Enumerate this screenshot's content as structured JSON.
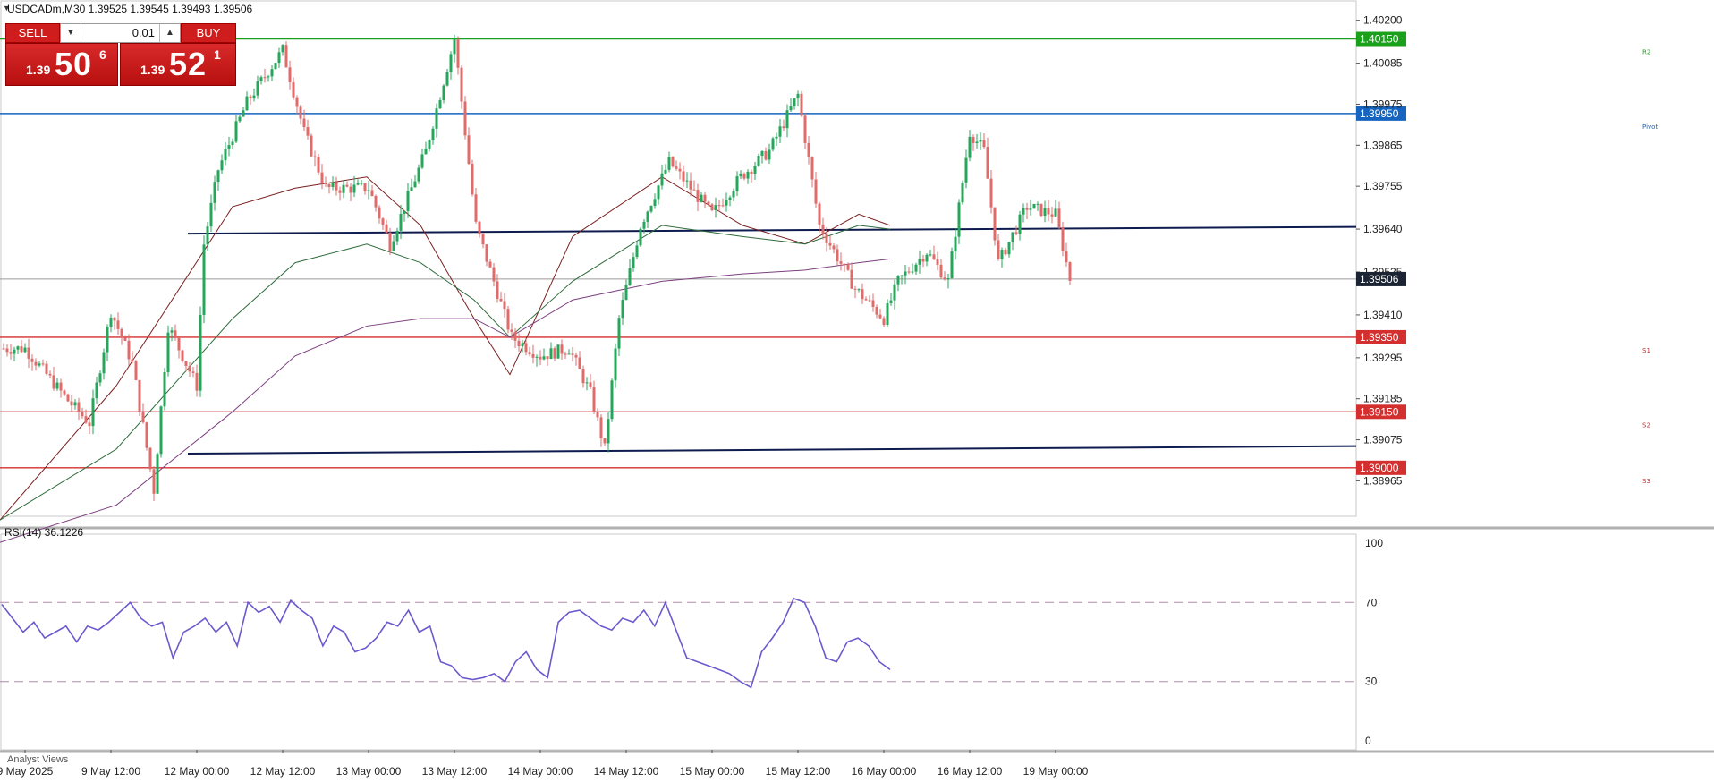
{
  "header": {
    "symbol_line": "USDCADm,M30  1.39525 1.39545 1.39493 1.39506",
    "symbol_icon": "triangle-down-icon"
  },
  "trade_panel": {
    "sell_label": "SELL",
    "buy_label": "BUY",
    "lot_value": "0.01",
    "sell_small": "1.39",
    "sell_big": "50",
    "sell_sup": "6",
    "buy_small": "1.39",
    "buy_big": "52",
    "buy_sup": "1",
    "accent": "#cf1c1c"
  },
  "rsi_label": "RSI(14) 36.1226",
  "analyst_tab": "Analyst Views",
  "chart_data": {
    "type": "candlestick",
    "symbol": "USDCADm",
    "timeframe": "M30",
    "ohlc_last": {
      "open": 1.39525,
      "high": 1.39545,
      "low": 1.39493,
      "close": 1.39506
    },
    "current_price": 1.39506,
    "current_price_label": "1.39506",
    "y_ticks": [
      "1.40200",
      "1.40085",
      "1.39975",
      "1.39865",
      "1.39755",
      "1.39640",
      "1.39525",
      "1.39410",
      "1.39295",
      "1.39185",
      "1.39075",
      "1.38965"
    ],
    "y_range": [
      1.3887,
      1.4024
    ],
    "x_ticks": [
      "9 May 2025",
      "9 May 12:00",
      "12 May 00:00",
      "12 May 12:00",
      "13 May 00:00",
      "13 May 12:00",
      "14 May 00:00",
      "14 May 12:00",
      "15 May 00:00",
      "15 May 12:00",
      "16 May 00:00",
      "16 May 12:00",
      "19 May 00:00"
    ],
    "levels": [
      {
        "name": "R2",
        "price": 1.4015,
        "label": "1.40150",
        "color": "#1aa01a"
      },
      {
        "name": "Pivot",
        "price": 1.3995,
        "label": "1.39950",
        "color": "#1565c0"
      },
      {
        "name": "S1",
        "price": 1.3935,
        "label": "1.39350",
        "color": "#d32f2f"
      },
      {
        "name": "S2",
        "price": 1.3915,
        "label": "1.39150",
        "color": "#d32f2f"
      },
      {
        "name": "S3",
        "price": 1.39,
        "label": "1.39000",
        "color": "#d32f2f"
      }
    ],
    "trendlines": [
      {
        "from": [
          "12 May 00:00",
          1.39628
        ],
        "to": [
          "right_edge",
          1.39646
        ],
        "color": "#0d1b4f"
      },
      {
        "from": [
          "12 May 00:00",
          1.39038
        ],
        "to": [
          "right_edge",
          1.39058
        ],
        "color": "#0d1b4f"
      }
    ],
    "price_path": [
      {
        "t": "9 May 2025",
        "p": 1.3932
      },
      {
        "t": "9 May 06:00",
        "p": 1.3918
      },
      {
        "t": "9 May 09:00",
        "p": 1.3912
      },
      {
        "t": "9 May 12:00",
        "p": 1.3942
      },
      {
        "t": "9 May 15:00",
        "p": 1.3928
      },
      {
        "t": "9 May 18:00",
        "p": 1.3894
      },
      {
        "t": "9 May 20:00",
        "p": 1.3938
      },
      {
        "t": "12 May 00:00",
        "p": 1.3922
      },
      {
        "t": "12 May 01:00",
        "p": 1.396
      },
      {
        "t": "12 May 03:00",
        "p": 1.398
      },
      {
        "t": "12 May 07:00",
        "p": 1.3998
      },
      {
        "t": "12 May 12:00",
        "p": 1.4012
      },
      {
        "t": "12 May 15:00",
        "p": 1.399
      },
      {
        "t": "12 May 18:00",
        "p": 1.3975
      },
      {
        "t": "13 May 00:00",
        "p": 1.3975
      },
      {
        "t": "13 May 03:00",
        "p": 1.396
      },
      {
        "t": "13 May 08:00",
        "p": 1.3985
      },
      {
        "t": "13 May 12:00",
        "p": 1.4015
      },
      {
        "t": "13 May 15:00",
        "p": 1.3965
      },
      {
        "t": "13 May 20:00",
        "p": 1.3935
      },
      {
        "t": "14 May 00:00",
        "p": 1.393
      },
      {
        "t": "14 May 04:00",
        "p": 1.3932
      },
      {
        "t": "14 May 07:00",
        "p": 1.392
      },
      {
        "t": "14 May 09:00",
        "p": 1.3905
      },
      {
        "t": "14 May 11:00",
        "p": 1.394
      },
      {
        "t": "14 May 14:00",
        "p": 1.3965
      },
      {
        "t": "14 May 18:00",
        "p": 1.3982
      },
      {
        "t": "15 May 00:00",
        "p": 1.3968
      },
      {
        "t": "15 May 04:00",
        "p": 1.3978
      },
      {
        "t": "15 May 08:00",
        "p": 1.3985
      },
      {
        "t": "15 May 12:00",
        "p": 1.4
      },
      {
        "t": "15 May 15:00",
        "p": 1.3965
      },
      {
        "t": "15 May 20:00",
        "p": 1.3948
      },
      {
        "t": "16 May 00:00",
        "p": 1.394
      },
      {
        "t": "16 May 02:00",
        "p": 1.395
      },
      {
        "t": "16 May 06:00",
        "p": 1.3958
      },
      {
        "t": "16 May 09:00",
        "p": 1.395
      },
      {
        "t": "16 May 12:00",
        "p": 1.399
      },
      {
        "t": "16 May 14:00",
        "p": 1.3985
      },
      {
        "t": "16 May 16:00",
        "p": 1.3955
      },
      {
        "t": "16 May 20:00",
        "p": 1.397
      },
      {
        "t": "19 May 00:00",
        "p": 1.3968
      },
      {
        "t": "19 May 02:00",
        "p": 1.39506
      }
    ],
    "moving_averages": [
      {
        "color": "#7a1f1f",
        "path": [
          [
            1.3886
          ],
          [
            1.3922
          ],
          [
            1.397
          ],
          [
            1.3975
          ],
          [
            1.3978
          ],
          [
            1.3965
          ],
          [
            1.394
          ],
          [
            1.3925
          ],
          [
            1.3962
          ],
          [
            1.3978
          ],
          [
            1.3965
          ],
          [
            1.396
          ],
          [
            1.3968
          ],
          [
            1.3965
          ]
        ]
      },
      {
        "color": "#2e6b3a",
        "path": [
          [
            1.3886
          ],
          [
            1.3905
          ],
          [
            1.394
          ],
          [
            1.3955
          ],
          [
            1.396
          ],
          [
            1.3955
          ],
          [
            1.3945
          ],
          [
            1.3935
          ],
          [
            1.395
          ],
          [
            1.3965
          ],
          [
            1.3962
          ],
          [
            1.396
          ],
          [
            1.3965
          ],
          [
            1.3964
          ]
        ]
      },
      {
        "color": "#7b3f7f",
        "path": [
          [
            1.388
          ],
          [
            1.389
          ],
          [
            1.3915
          ],
          [
            1.393
          ],
          [
            1.3938
          ],
          [
            1.394
          ],
          [
            1.394
          ],
          [
            1.3935
          ],
          [
            1.3945
          ],
          [
            1.395
          ],
          [
            1.3952
          ],
          [
            1.3953
          ],
          [
            1.3955
          ],
          [
            1.3956
          ]
        ]
      }
    ],
    "rsi": {
      "period": 14,
      "value": 36.1226,
      "ylim": [
        0,
        100
      ],
      "y_ticks": [
        "100",
        "70",
        "30",
        "0"
      ],
      "levels": [
        70,
        30
      ],
      "color": "#6a5acd",
      "values": [
        69,
        62,
        55,
        60,
        52,
        55,
        58,
        50,
        58,
        56,
        60,
        65,
        70,
        62,
        58,
        60,
        42,
        55,
        58,
        62,
        55,
        60,
        48,
        70,
        65,
        68,
        60,
        71,
        66,
        62,
        48,
        58,
        55,
        45,
        47,
        52,
        60,
        58,
        66,
        55,
        58,
        40,
        38,
        32,
        31,
        32,
        34,
        30,
        40,
        45,
        36,
        32,
        60,
        65,
        66,
        62,
        58,
        56,
        62,
        60,
        66,
        58,
        70,
        56,
        42,
        40,
        38,
        36,
        34,
        30,
        27,
        45,
        52,
        60,
        72,
        70,
        58,
        42,
        40,
        50,
        52,
        48,
        40,
        36
      ]
    }
  }
}
